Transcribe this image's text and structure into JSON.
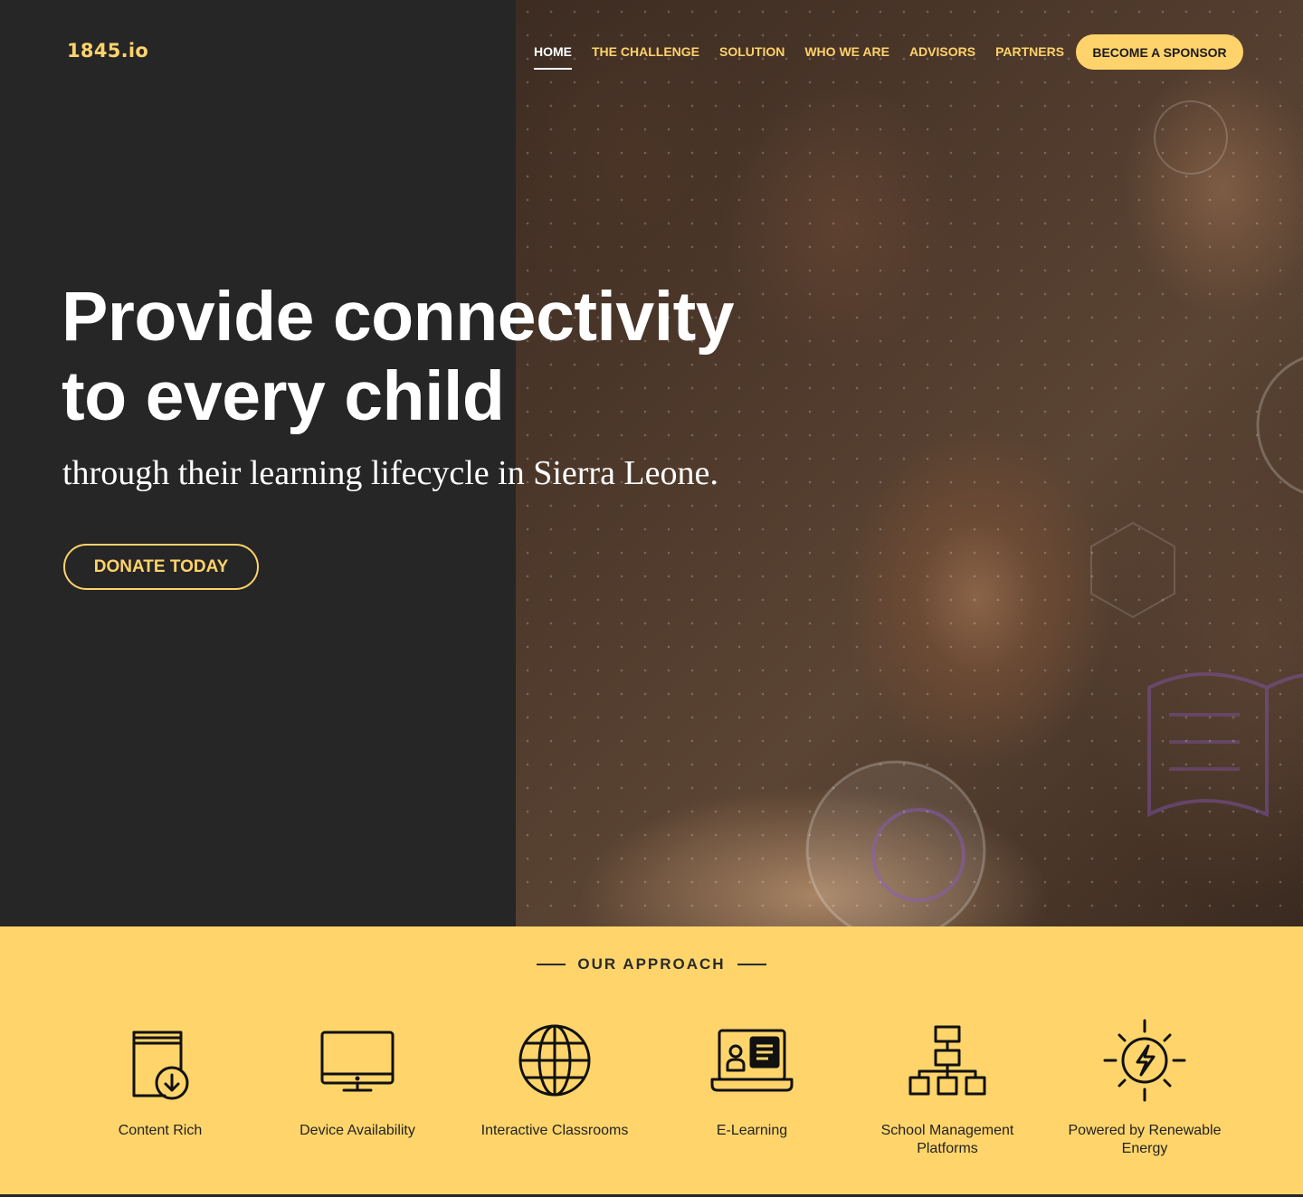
{
  "brand": {
    "logo": "1845.io",
    "accent": "#ffd36b",
    "dark": "#262626"
  },
  "nav": {
    "items": [
      {
        "label": "HOME",
        "active": true
      },
      {
        "label": "THE CHALLENGE",
        "active": false
      },
      {
        "label": "SOLUTION",
        "active": false
      },
      {
        "label": "WHO WE ARE",
        "active": false
      },
      {
        "label": "ADVISORS",
        "active": false
      },
      {
        "label": "PARTNERS",
        "active": false
      }
    ],
    "cta": "BECOME A SPONSOR"
  },
  "hero": {
    "headline_line1": "Provide connectivity",
    "headline_line2": "to every child",
    "subline": "through their learning lifecycle in Sierra Leone.",
    "cta": "DONATE TODAY"
  },
  "approach": {
    "title": "OUR APPROACH",
    "features": [
      {
        "label": "Content Rich",
        "icon": "book-download-icon"
      },
      {
        "label": "Device Availability",
        "icon": "monitor-icon"
      },
      {
        "label": "Interactive Classrooms",
        "icon": "globe-icon"
      },
      {
        "label": "E-Learning",
        "icon": "laptop-learning-icon"
      },
      {
        "label": "School Management Platforms",
        "icon": "org-chart-icon"
      },
      {
        "label": "Powered by Renewable Energy",
        "icon": "solar-energy-icon"
      }
    ]
  }
}
